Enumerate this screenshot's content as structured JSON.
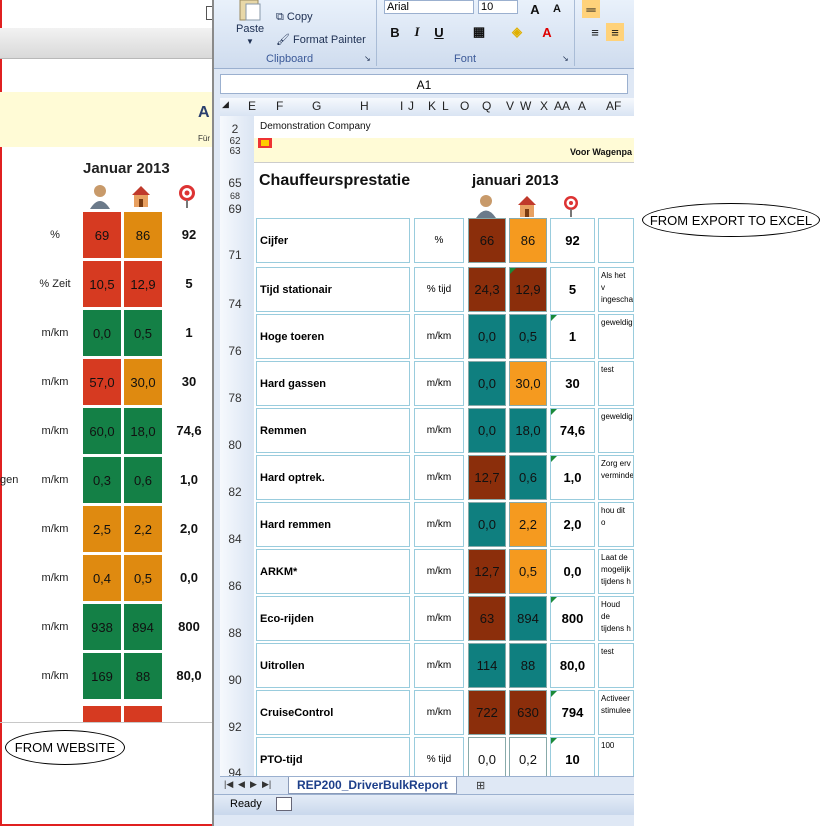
{
  "website": {
    "title": "Januar 2013",
    "header_letter": "A",
    "header_sub": "Für",
    "rows": [
      {
        "label": "",
        "unit": "%",
        "v1": "69",
        "v2": "86",
        "target": "92",
        "c1": "#d63a21",
        "c2": "#df8a10"
      },
      {
        "label": "",
        "unit": "% Zeit",
        "v1": "10,5",
        "v2": "12,9",
        "target": "5",
        "c1": "#d63a21",
        "c2": "#d63a21"
      },
      {
        "label": "",
        "unit": "m/km",
        "v1": "0,0",
        "v2": "0,5",
        "target": "1",
        "c1": "#148046",
        "c2": "#148046"
      },
      {
        "label": "",
        "unit": "m/km",
        "v1": "57,0",
        "v2": "30,0",
        "target": "30",
        "c1": "#d63a21",
        "c2": "#df8a10"
      },
      {
        "label": "",
        "unit": "m/km",
        "v1": "60,0",
        "v2": "18,0",
        "target": "74,6",
        "c1": "#148046",
        "c2": "#148046"
      },
      {
        "label": "gen",
        "unit": "m/km",
        "v1": "0,3",
        "v2": "0,6",
        "target": "1,0",
        "c1": "#148046",
        "c2": "#148046"
      },
      {
        "label": "",
        "unit": "m/km",
        "v1": "2,5",
        "v2": "2,2",
        "target": "2,0",
        "c1": "#df8a10",
        "c2": "#df8a10"
      },
      {
        "label": "",
        "unit": "m/km",
        "v1": "0,4",
        "v2": "0,5",
        "target": "0,0",
        "c1": "#df8a10",
        "c2": "#df8a10"
      },
      {
        "label": "",
        "unit": "m/km",
        "v1": "938",
        "v2": "894",
        "target": "800",
        "c1": "#148046",
        "c2": "#148046"
      },
      {
        "label": "",
        "unit": "m/km",
        "v1": "169",
        "v2": "88",
        "target": "80,0",
        "c1": "#148046",
        "c2": "#148046"
      }
    ],
    "callout": "FROM WEBSITE"
  },
  "excel": {
    "clipboard": {
      "paste": "Paste",
      "copy": "Copy",
      "format_painter": "Format Painter",
      "group_label": "Clipboard"
    },
    "font": {
      "name": "Arial",
      "size": "10",
      "group_label": "Font",
      "bold": "B",
      "italic": "I",
      "underline": "U",
      "grow": "A",
      "shrink": "A"
    },
    "name_box": "A1",
    "columns": [
      "E",
      "F",
      "G",
      "H",
      "I",
      "J",
      "K",
      "L",
      "O",
      "Q",
      "V",
      "W",
      "X",
      "AA",
      "A",
      "AF"
    ],
    "row_numbers": [
      "2",
      "62",
      "63",
      "65",
      "68",
      "69",
      "71",
      "74",
      "76",
      "78",
      "80",
      "82",
      "84",
      "86",
      "88",
      "90",
      "92",
      "94"
    ],
    "company": "Demonstration Company",
    "voor": "Voor Wagenpa",
    "title": "Chauffeursprestatie",
    "month": "januari 2013",
    "rows": [
      {
        "label": "Cijfer",
        "unit": "%",
        "v1": "66",
        "v2": "86",
        "target": "92",
        "comment": "",
        "c1": "#8b2e0b",
        "c2": "#f59a1f",
        "t1": false,
        "t2": false,
        "t3": false
      },
      {
        "label": "Tijd stationair",
        "unit": "% tijd",
        "v1": "24,3",
        "v2": "12,9",
        "target": "5",
        "comment": "Als het v ingescha",
        "c1": "#8b2e0b",
        "c2": "#8b2e0b",
        "t1": false,
        "t2": true,
        "t3": false
      },
      {
        "label": "Hoge toeren",
        "unit": "m/km",
        "v1": "0,0",
        "v2": "0,5",
        "target": "1",
        "comment": "geweldig",
        "c1": "#0f7f7f",
        "c2": "#0f7f7f",
        "t1": false,
        "t2": false,
        "t3": true
      },
      {
        "label": "Hard gassen",
        "unit": "m/km",
        "v1": "0,0",
        "v2": "30,0",
        "target": "30",
        "comment": "test",
        "c1": "#0f7f7f",
        "c2": "#f59a1f",
        "t1": false,
        "t2": false,
        "t3": false
      },
      {
        "label": "Remmen",
        "unit": "m/km",
        "v1": "0,0",
        "v2": "18,0",
        "target": "74,6",
        "comment": "geweldig",
        "c1": "#0f7f7f",
        "c2": "#0f7f7f",
        "t1": false,
        "t2": false,
        "t3": true
      },
      {
        "label": "Hard optrek.",
        "unit": "m/km",
        "v1": "12,7",
        "v2": "0,6",
        "target": "1,0",
        "comment": "Zorg erv verminde",
        "c1": "#8b2e0b",
        "c2": "#0f7f7f",
        "t1": false,
        "t2": false,
        "t3": true
      },
      {
        "label": "Hard remmen",
        "unit": "m/km",
        "v1": "0,0",
        "v2": "2,2",
        "target": "2,0",
        "comment": "hou dit o",
        "c1": "#0f7f7f",
        "c2": "#f59a1f",
        "t1": false,
        "t2": false,
        "t3": false
      },
      {
        "label": "ARKM*",
        "unit": "m/km",
        "v1": "12,7",
        "v2": "0,5",
        "target": "0,0",
        "comment": "Laat de mogelijk tijdens h",
        "c1": "#8b2e0b",
        "c2": "#f59a1f",
        "t1": false,
        "t2": false,
        "t3": false
      },
      {
        "label": "Eco-rijden",
        "unit": "m/km",
        "v1": "63",
        "v2": "894",
        "target": "800",
        "comment": "Houd de tijdens h",
        "c1": "#8b2e0b",
        "c2": "#0f7f7f",
        "t1": false,
        "t2": false,
        "t3": true
      },
      {
        "label": "Uitrollen",
        "unit": "m/km",
        "v1": "114",
        "v2": "88",
        "target": "80,0",
        "comment": "test",
        "c1": "#0f7f7f",
        "c2": "#0f7f7f",
        "t1": false,
        "t2": false,
        "t3": false
      },
      {
        "label": "CruiseControl",
        "unit": "m/km",
        "v1": "722",
        "v2": "630",
        "target": "794",
        "comment": "Activeer stimulee",
        "c1": "#8b2e0b",
        "c2": "#8b2e0b",
        "t1": false,
        "t2": false,
        "t3": true
      },
      {
        "label": "PTO-tijd",
        "unit": "% tijd",
        "v1": "0,0",
        "v2": "0,2",
        "target": "10",
        "comment": "100",
        "c1": "#ffffff",
        "c2": "#ffffff",
        "t1": false,
        "t2": false,
        "t3": true
      }
    ],
    "sheet_tab": "REP200_DriverBulkReport",
    "status": "Ready",
    "callout": "FROM EXPORT TO EXCEL"
  }
}
